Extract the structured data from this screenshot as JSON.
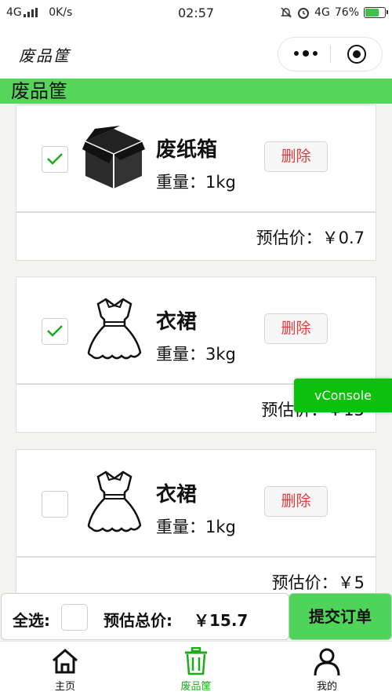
{
  "status_bar": {
    "network": "4G",
    "speed": "0K/s",
    "time": "02:57",
    "network_right": "4G",
    "battery": "76%",
    "battery_level": 0.76
  },
  "nav": {
    "title": "废品筐"
  },
  "section_title": "废品筐",
  "items": [
    {
      "name": "废纸箱",
      "weight": "重量：1kg",
      "delete_label": "删除",
      "price": "预估价：￥0.7",
      "checked": true,
      "icon": "box-icon"
    },
    {
      "name": "衣裙",
      "weight": "重量：3kg",
      "delete_label": "删除",
      "price": "预估价：￥15",
      "checked": true,
      "icon": "dress-icon"
    },
    {
      "name": "衣裙",
      "weight": "重量：1kg",
      "delete_label": "删除",
      "price": "预估价：￥5",
      "checked": false,
      "icon": "dress-icon"
    }
  ],
  "vconsole": "vConsole",
  "footer": {
    "select_all_label": "全选:",
    "total_label": "预估总价:",
    "total_value": "￥15.7",
    "submit_label": "提交订单"
  },
  "tabs": [
    {
      "label": "主页",
      "icon": "home-icon",
      "active": false
    },
    {
      "label": "废品筐",
      "icon": "trash-icon",
      "active": true
    },
    {
      "label": "我的",
      "icon": "user-icon",
      "active": false
    }
  ],
  "colors": {
    "accent": "#55d65a",
    "delete": "#e33b3b",
    "vconsole": "#0bc10b",
    "check": "#1aad19"
  }
}
